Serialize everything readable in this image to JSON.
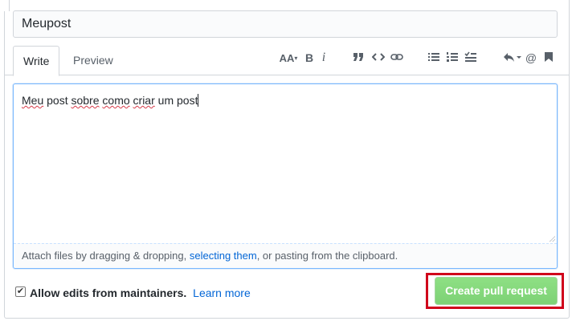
{
  "title_field": {
    "value": "Meupost"
  },
  "tabs": {
    "write": "Write",
    "preview": "Preview"
  },
  "toolbar": {
    "header": "AA",
    "bold": "B",
    "italic": "i",
    "mention": "@",
    "icons": [
      "text-size-icon",
      "bold-icon",
      "italic-icon",
      "quote-icon",
      "code-icon",
      "link-icon",
      "bulleted-list-icon",
      "numbered-list-icon",
      "task-list-icon",
      "reply-icon",
      "mention-icon",
      "bookmark-icon"
    ]
  },
  "editor": {
    "words": [
      "Meu",
      "post",
      "sobre",
      "como",
      "criar",
      "um",
      "post"
    ]
  },
  "dropzone": {
    "prefix": "Attach files by dragging & dropping, ",
    "link": "selecting them",
    "suffix": ", or pasting from the clipboard."
  },
  "footer": {
    "checkbox_label": "Allow edits from maintainers.",
    "learn_more": "Learn more",
    "checked": true,
    "create_button": "Create pull request"
  },
  "colors": {
    "accent_link": "#0366d6",
    "button_green": "#7dd175",
    "highlight_red": "#d0021b",
    "focus_blue": "#79b8ff"
  }
}
